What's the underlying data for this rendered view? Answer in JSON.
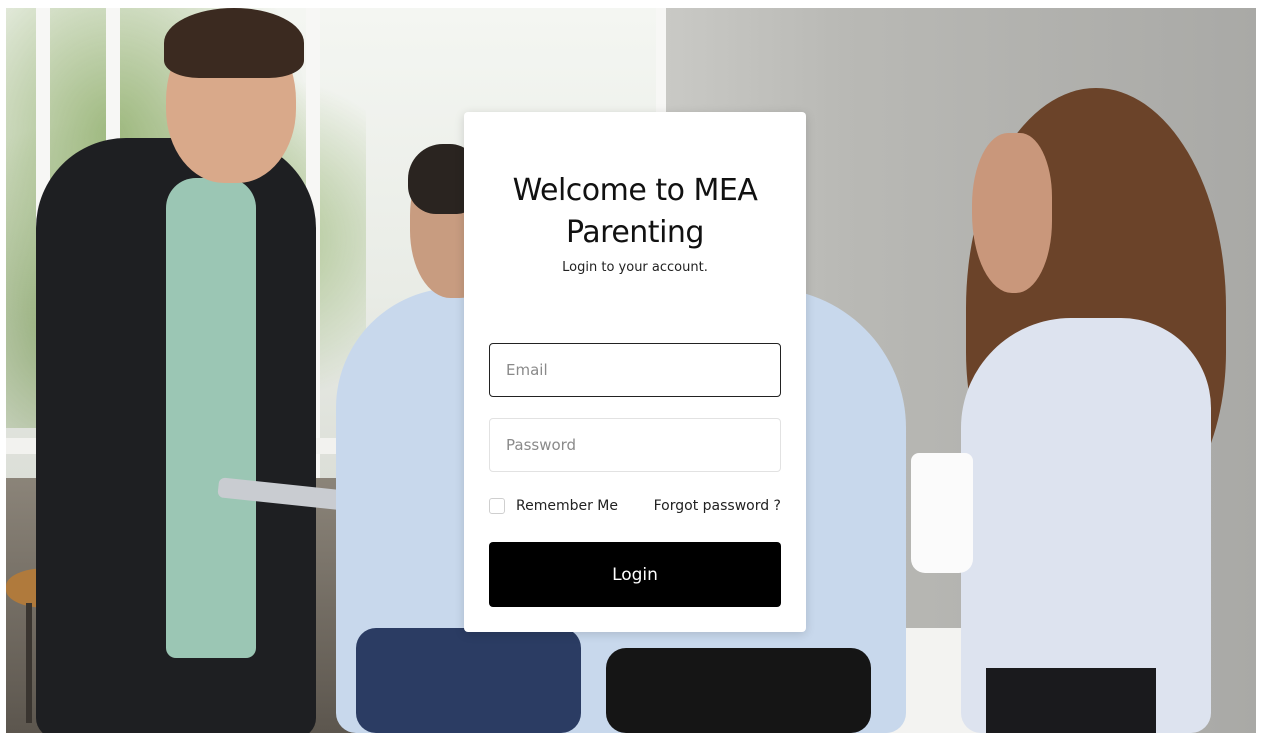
{
  "login": {
    "title": "Welcome to MEA Parenting",
    "subtitle": "Login to your account.",
    "email_placeholder": "Email",
    "password_placeholder": "Password",
    "remember_label": "Remember Me",
    "forgot_label": "Forgot password ?",
    "login_label": "Login"
  },
  "colors": {
    "button_bg": "#000000",
    "button_text": "#ffffff",
    "card_bg": "#ffffff"
  }
}
